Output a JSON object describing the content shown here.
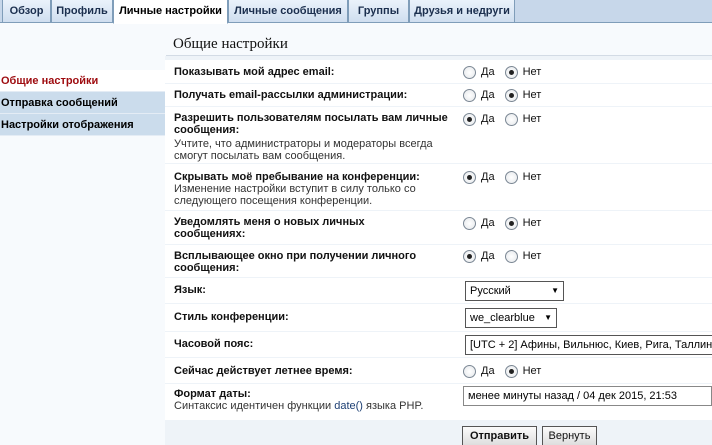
{
  "tabs": [
    {
      "label": "Обзор",
      "active": false
    },
    {
      "label": "Профиль",
      "active": false
    },
    {
      "label": "Личные настройки",
      "active": true
    },
    {
      "label": "Личные сообщения",
      "active": false
    },
    {
      "label": "Группы",
      "active": false
    },
    {
      "label": "Друзья и недруги",
      "active": false
    }
  ],
  "sidebar": {
    "items": [
      {
        "label": "Общие настройки",
        "active": true
      },
      {
        "label": "Отправка сообщений",
        "active": false
      },
      {
        "label": "Настройки отображения",
        "active": false
      }
    ]
  },
  "main": {
    "title": "Общие настройки",
    "yes_label": "Да",
    "no_label": "Нет",
    "settings": {
      "show_email": {
        "label": "Показывать мой адрес email:",
        "value": "Нет"
      },
      "admin_mail": {
        "label": "Получать email-рассылки администрации:",
        "value": "Нет"
      },
      "allow_pm": {
        "label": "Разрешить пользователям посылать вам личные сообщения:",
        "explain": "Учтите, что администраторы и модераторы всегда смогут посылать вам сообщения.",
        "value": "Да"
      },
      "hide_online": {
        "label": "Скрывать моё пребывание на конференции:",
        "explain": "Изменение настройки вступит в силу только со следующего посещения конференции.",
        "value": "Да"
      },
      "notify_pm": {
        "label": "Уведомлять меня о новых личных сообщениях:",
        "value": "Нет"
      },
      "popup_pm": {
        "label": "Всплывающее окно при получении личного сообщения:",
        "value": "Да"
      },
      "language": {
        "label": "Язык:",
        "value": "Русский"
      },
      "style": {
        "label": "Стиль конференции:",
        "value": "we_clearblue"
      },
      "timezone": {
        "label": "Часовой пояс:",
        "value": "[UTC + 2] Афины, Вильнюс, Киев, Рига, Таллин"
      },
      "dst": {
        "label": "Сейчас действует летнее время:",
        "value": "Нет"
      },
      "date_format": {
        "label": "Формат даты:",
        "explain_before": "Синтаксис идентичен функции ",
        "explain_code": "date()",
        "explain_after": " языка PHP.",
        "value": "менее минуты назад / 04 дек 2015, 21:53"
      }
    }
  },
  "buttons": {
    "submit": "Отправить",
    "reset": "Вернуть"
  },
  "colors": {
    "accent_active": "#9e0b0f",
    "tab_bar": "#c7d7ea",
    "sidebar_item": "#cbdcec",
    "panel_bg": "#eef3f8"
  }
}
